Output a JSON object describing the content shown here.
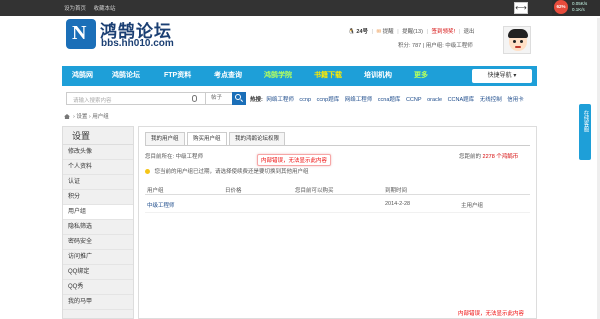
{
  "topbar": {
    "links": [
      "设为首页",
      "收藏本站"
    ],
    "toggle_icon": "arrows-horizontal-icon"
  },
  "netwidget": {
    "percent": "62%",
    "up": "0.05K/s",
    "down": "0.1K/s"
  },
  "logo": {
    "title": "鸿鹄论坛",
    "url": "bbs.hh010.com"
  },
  "user": {
    "id_num": "24号",
    "reminder": "提醒",
    "notice": "提醒(13)",
    "signin": "签到领奖!",
    "logout": "退出",
    "points_label": "积分: 787",
    "group_label": "用户组: 中级工程师"
  },
  "nav": {
    "items": [
      "鸿鹄网",
      "鸿鹄论坛",
      "FTP资料",
      "考点查询",
      "鸿鹄学院",
      "书籍下载",
      "培训机构",
      "更多"
    ],
    "quick_nav": "快捷导航"
  },
  "search": {
    "placeholder": "请输入搜索内容",
    "select": "帖子",
    "hot_label": "热搜:",
    "hot_words": [
      "网络工程师",
      "ccnp",
      "ccnp题库",
      "网络工程师",
      "ccna题库",
      "CCNP",
      "oracle",
      "CCNA题库",
      "无线控制",
      "信用卡"
    ]
  },
  "breadcrumb": {
    "items": [
      "设置",
      "用户组"
    ]
  },
  "sidebar": {
    "title": "设置",
    "items": [
      "修改头像",
      "个人资料",
      "认证",
      "积分",
      "用户组",
      "隐私筛选",
      "密码安全",
      "访问推广",
      "QQ绑定",
      "QQ秀",
      "我的马甲"
    ]
  },
  "tabs": [
    "我的用户组",
    "购买用户组",
    "我的鸿鹄论坛权限"
  ],
  "group_info": {
    "current": "您目前所在: 中级工程师",
    "distance_prefix": "您距前的",
    "distance_value": "2278 个鸿鹄币",
    "error": "内部错误，无法显示此内容"
  },
  "notice": "您当前的用户组已过期，请选择使续费还是要切换到其他用户组",
  "table": {
    "headers": [
      "用户组",
      "日价格",
      "您目前可以购买",
      "到期时间",
      ""
    ],
    "rows": [
      {
        "group": "中级工程师",
        "price": "",
        "can_buy": "",
        "expire": "2014-2-28",
        "action": "主用户组"
      }
    ]
  },
  "bottom_error": "内部错误，无法显示此内容",
  "service": "在线客服"
}
